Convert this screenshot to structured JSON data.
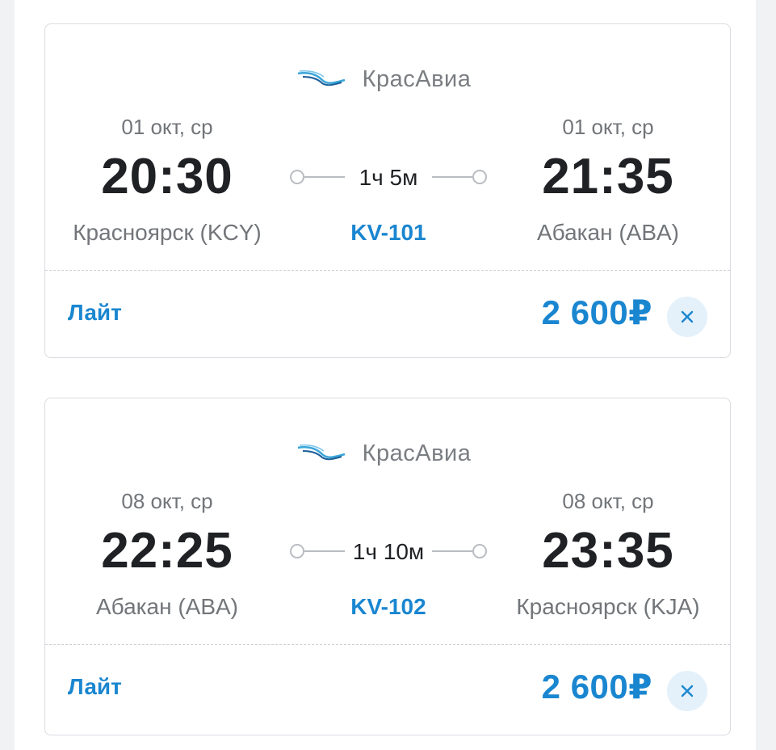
{
  "flights": [
    {
      "airline": "КрасАвиа",
      "departure": {
        "date": "01 окт, ср",
        "time": "20:30",
        "place": "Красноярск (KCY)"
      },
      "duration": "1ч 5м",
      "flight_number": "KV-101",
      "arrival": {
        "date": "01 окт, ср",
        "time": "21:35",
        "place": "Абакан (ABA)"
      },
      "fare": "Лайт",
      "price": "2 600₽"
    },
    {
      "airline": "КрасАвиа",
      "departure": {
        "date": "08 окт, ср",
        "time": "22:25",
        "place": "Абакан (ABA)"
      },
      "duration": "1ч 10м",
      "flight_number": "KV-102",
      "arrival": {
        "date": "08 окт, ср",
        "time": "23:35",
        "place": "Красноярск (KJA)"
      },
      "fare": "Лайт",
      "price": "2 600₽"
    }
  ],
  "icons": {
    "airline_logo": "krasavia-logo",
    "remove": "close-icon"
  },
  "colors": {
    "accent": "#1a86d0",
    "time_text": "#1f2124",
    "secondary_text": "#727579",
    "remove_bg": "#e4f1fb"
  }
}
